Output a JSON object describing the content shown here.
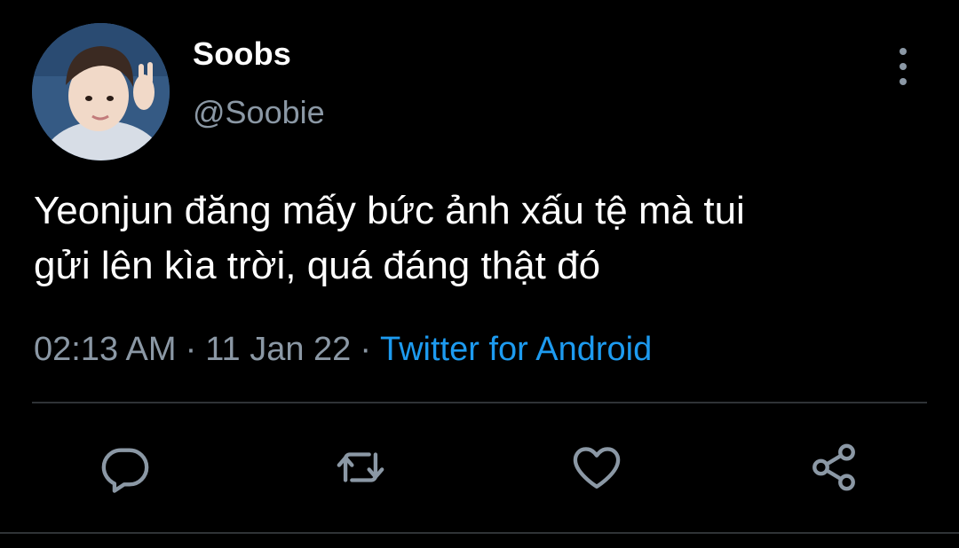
{
  "author": {
    "display_name": "Soobs",
    "handle": "@Soobie"
  },
  "tweet": {
    "text": "Yeonjun đăng mấy bức ảnh xấu tệ mà tui\ngửi lên kìa trời, quá đáng thật đó",
    "time": "02:13 AM",
    "date": "11 Jan 22",
    "source": "Twitter for Android",
    "separator": "·"
  },
  "icons": {
    "avatar": "avatar-photo",
    "more": "more-vertical-icon",
    "reply": "reply-icon",
    "retweet": "retweet-icon",
    "like": "heart-icon",
    "share": "share-icon"
  },
  "colors": {
    "background": "#000000",
    "text_primary": "#ffffff",
    "text_secondary": "#8b98a5",
    "accent": "#1d9bf0",
    "divider": "#2f3336"
  }
}
